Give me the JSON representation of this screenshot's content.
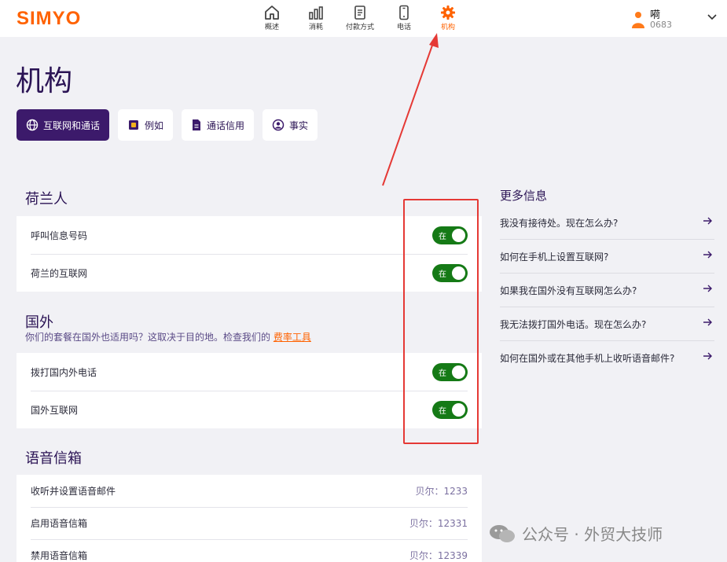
{
  "header": {
    "logo": "SIMYO",
    "nav": [
      {
        "label": "概述",
        "icon": "home-icon"
      },
      {
        "label": "消耗",
        "icon": "bar-chart-icon"
      },
      {
        "label": "付款方式",
        "icon": "document-icon"
      },
      {
        "label": "电话",
        "icon": "phone-icon"
      },
      {
        "label": "机构",
        "icon": "gear-icon",
        "active": true
      }
    ],
    "user": {
      "name": "嗬",
      "phone": "0683"
    }
  },
  "page": {
    "title": "机构"
  },
  "tabs": [
    {
      "label": "互联网和通话",
      "icon": "globe-icon",
      "active": true
    },
    {
      "label": "例如",
      "icon": "sim-card-icon"
    },
    {
      "label": "通话信用",
      "icon": "file-icon"
    },
    {
      "label": "事实",
      "icon": "person-circle-icon"
    }
  ],
  "sections": {
    "netherlands": {
      "title": "荷兰人",
      "rows": [
        {
          "label": "呼叫信息号码",
          "toggle": "在"
        },
        {
          "label": "荷兰的互联网",
          "toggle": "在"
        }
      ]
    },
    "abroad": {
      "title": "国外",
      "subtitle": "你们的套餐在国外也适用吗？这取决于目的地。检查我们的",
      "subtitle_link": "费率工具",
      "rows": [
        {
          "label": "拨打国内外电话",
          "toggle": "在"
        },
        {
          "label": "国外互联网",
          "toggle": "在"
        }
      ]
    },
    "voicemail": {
      "title": "语音信箱",
      "rows": [
        {
          "label": "收听并设置语音邮件",
          "value": "贝尔：1233"
        },
        {
          "label": "启用语音信箱",
          "value": "贝尔：12331"
        },
        {
          "label": "禁用语音信箱",
          "value": "贝尔：12339"
        }
      ]
    }
  },
  "more_info": {
    "title": "更多信息",
    "items": [
      "我没有接待处。现在怎么办?",
      "如何在手机上设置互联网?",
      "如果我在国外没有互联网怎么办?",
      "我无法拨打国外电话。现在怎么办?",
      "如何在国外或在其他手机上收听语音邮件?"
    ]
  },
  "watermark": "公众号 · 外贸大技师",
  "colors": {
    "brand": "#ff6200",
    "primary": "#3c1a6b",
    "toggle_on": "#157a16",
    "annotation": "#e53935"
  }
}
